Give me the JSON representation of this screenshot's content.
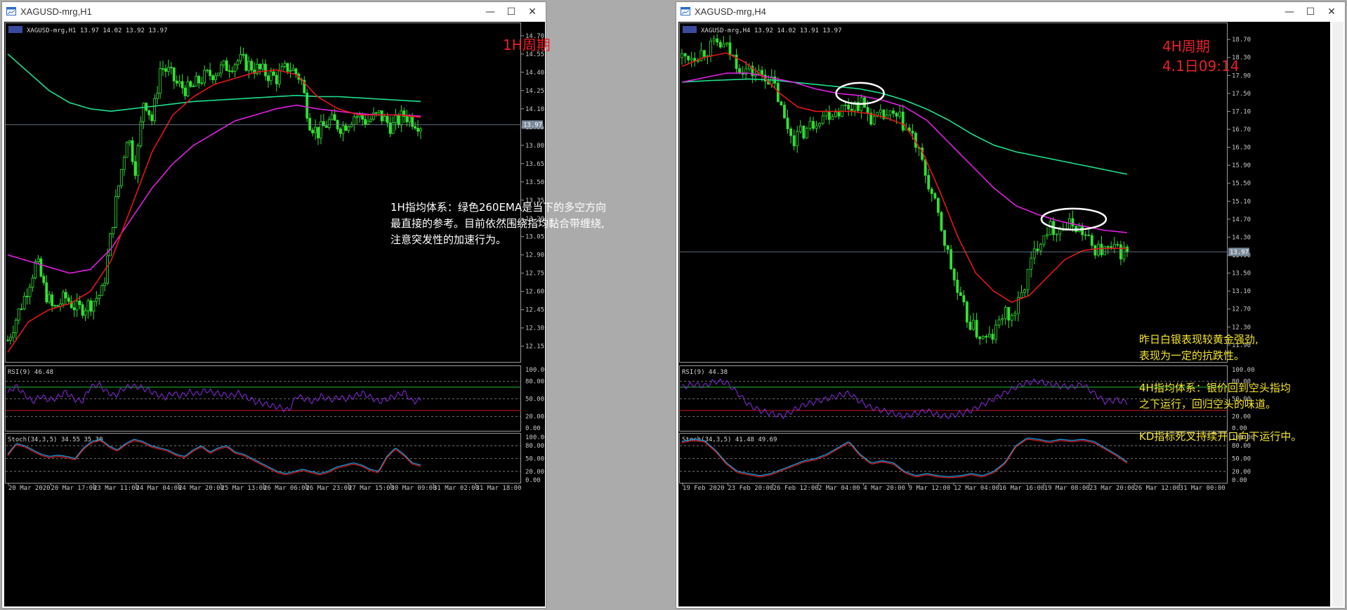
{
  "windows": [
    {
      "title": "XAGUSD-mrg,H1",
      "ticker": "XAGUSD-mrg,H1  13.97 14.02 13.92 13.97",
      "period_label": "1H周期",
      "period_sub": "",
      "notes_color": "#ffffff",
      "notes": [
        "1H指均体系：绿色260EMA是当下的多空方向",
        "最直接的参考。目前依然围绕指均黏合带缠绕,",
        "注意突发性的加速行为。"
      ],
      "current_price": "13.97",
      "rsi_label": "RSI(9) 46.48",
      "stoch_label": "Stoch(34,3,5) 34.55 35.30",
      "date_labels": [
        "20 Mar 2020",
        "20 Mar 17:00",
        "23 Mar 11:00",
        "24 Mar 04:00",
        "24 Mar 20:00",
        "25 Mar 13:00",
        "26 Mar 06:00",
        "26 Mar 23:00",
        "27 Mar 15:00",
        "30 Mar 09:00",
        "31 Mar 02:00",
        "31 Mar 18:00"
      ]
    },
    {
      "title": "XAGUSD-mrg,H4",
      "ticker": "XAGUSD-mrg,H4  13.92 14.02 13.91 13.97",
      "period_label": "4H周期",
      "period_sub": "4.1日09:14",
      "notes_color": "#f5e62a",
      "notes": [
        "昨日白银表现较黄金强劲,",
        "表现为一定的抗跌性。",
        "",
        "4H指均体系：银价回到空头指均",
        "之下运行，回归空头的味道。",
        "",
        "KD指标死叉持续开口向下运行中。"
      ],
      "current_price": "13.97",
      "rsi_label": "RSI(9) 44.38",
      "stoch_label": "Stoch(34,3,5) 41.48 49.69",
      "date_labels": [
        "19 Feb 2020",
        "23 Feb 20:00",
        "26 Feb 12:00",
        "2 Mar 04:00",
        "4 Mar 20:00",
        "9 Mar 12:00",
        "12 Mar 04:00",
        "16 Mar 16:00",
        "19 Mar 08:00",
        "23 Mar 20:00",
        "26 Mar 12:00",
        "31 Mar 00:00"
      ]
    }
  ],
  "controls": {
    "minimize": "—",
    "maximize": "☐",
    "close": "✕"
  },
  "chart_data": [
    {
      "type": "candlestick",
      "title": "XAGUSD-mrg,H1",
      "price_ticks": [
        "14.70",
        "14.55",
        "14.40",
        "14.25",
        "14.10",
        "13.95",
        "13.80",
        "13.65",
        "13.50",
        "13.35",
        "13.20",
        "13.05",
        "12.90",
        "12.75",
        "12.60",
        "12.45",
        "12.30",
        "12.15"
      ],
      "ylim": [
        12.05,
        14.78
      ],
      "close_path": [
        [
          0,
          12.2
        ],
        [
          4,
          12.55
        ],
        [
          7,
          12.85
        ],
        [
          9,
          12.6
        ],
        [
          11,
          12.45
        ],
        [
          14,
          12.55
        ],
        [
          17,
          12.45
        ],
        [
          20,
          12.5
        ],
        [
          23,
          12.6
        ],
        [
          26,
          13.3
        ],
        [
          29,
          13.9
        ],
        [
          31,
          13.6
        ],
        [
          33,
          14.2
        ],
        [
          35,
          14.0
        ],
        [
          37,
          14.45
        ],
        [
          39,
          14.4
        ],
        [
          41,
          14.3
        ],
        [
          44,
          14.25
        ],
        [
          47,
          14.35
        ],
        [
          50,
          14.4
        ],
        [
          53,
          14.45
        ],
        [
          56,
          14.5
        ],
        [
          59,
          14.45
        ],
        [
          62,
          14.4
        ],
        [
          65,
          14.35
        ],
        [
          68,
          14.45
        ],
        [
          71,
          14.35
        ],
        [
          73,
          14.0
        ],
        [
          75,
          13.9
        ],
        [
          78,
          14.0
        ],
        [
          81,
          13.95
        ],
        [
          84,
          14.05
        ],
        [
          87,
          14.0
        ],
        [
          90,
          14.05
        ],
        [
          93,
          13.95
        ],
        [
          96,
          14.05
        ],
        [
          100,
          13.97
        ]
      ],
      "ema_red": [
        [
          0,
          12.1
        ],
        [
          5,
          12.35
        ],
        [
          10,
          12.45
        ],
        [
          15,
          12.5
        ],
        [
          20,
          12.6
        ],
        [
          25,
          12.85
        ],
        [
          30,
          13.3
        ],
        [
          35,
          13.75
        ],
        [
          40,
          14.05
        ],
        [
          45,
          14.2
        ],
        [
          50,
          14.3
        ],
        [
          55,
          14.35
        ],
        [
          60,
          14.4
        ],
        [
          65,
          14.42
        ],
        [
          70,
          14.38
        ],
        [
          75,
          14.2
        ],
        [
          80,
          14.1
        ],
        [
          85,
          14.05
        ],
        [
          90,
          14.05
        ],
        [
          95,
          14.05
        ],
        [
          100,
          14.03
        ]
      ],
      "ema_magenta": [
        [
          0,
          12.9
        ],
        [
          5,
          12.85
        ],
        [
          10,
          12.8
        ],
        [
          15,
          12.75
        ],
        [
          20,
          12.78
        ],
        [
          25,
          12.95
        ],
        [
          30,
          13.2
        ],
        [
          35,
          13.45
        ],
        [
          40,
          13.65
        ],
        [
          45,
          13.8
        ],
        [
          50,
          13.9
        ],
        [
          55,
          14.0
        ],
        [
          60,
          14.05
        ],
        [
          65,
          14.1
        ],
        [
          70,
          14.13
        ],
        [
          75,
          14.1
        ],
        [
          80,
          14.08
        ],
        [
          85,
          14.06
        ],
        [
          90,
          14.05
        ],
        [
          95,
          14.05
        ],
        [
          100,
          14.04
        ]
      ],
      "ema_green": [
        [
          0,
          14.55
        ],
        [
          5,
          14.4
        ],
        [
          10,
          14.25
        ],
        [
          15,
          14.15
        ],
        [
          20,
          14.1
        ],
        [
          25,
          14.08
        ],
        [
          30,
          14.1
        ],
        [
          35,
          14.12
        ],
        [
          40,
          14.14
        ],
        [
          45,
          14.16
        ],
        [
          50,
          14.17
        ],
        [
          55,
          14.18
        ],
        [
          60,
          14.19
        ],
        [
          65,
          14.2
        ],
        [
          70,
          14.21
        ],
        [
          75,
          14.2
        ],
        [
          80,
          14.2
        ],
        [
          85,
          14.19
        ],
        [
          90,
          14.18
        ],
        [
          95,
          14.17
        ],
        [
          100,
          14.16
        ]
      ],
      "rsi_ticks": [
        "100.00",
        "80.00",
        "50.00",
        "20.00",
        "0.00"
      ],
      "rsi_values": [
        60,
        72,
        58,
        45,
        55,
        48,
        52,
        62,
        50,
        45,
        70,
        75,
        62,
        55,
        68,
        72,
        70,
        65,
        58,
        52,
        60,
        55,
        62,
        58,
        65,
        60,
        58,
        55,
        60,
        52,
        45,
        42,
        38,
        35,
        30,
        55,
        50,
        45,
        55,
        48,
        52,
        50,
        55,
        60,
        52,
        45,
        50,
        55,
        62,
        45,
        48
      ],
      "stoch_ticks": [
        "100.00",
        "80.00",
        "50.00",
        "20.00",
        "0.00"
      ],
      "stoch_values": [
        60,
        85,
        80,
        70,
        60,
        55,
        58,
        55,
        50,
        75,
        90,
        95,
        80,
        70,
        85,
        95,
        90,
        80,
        75,
        70,
        60,
        55,
        70,
        80,
        65,
        75,
        80,
        65,
        60,
        50,
        40,
        30,
        20,
        15,
        20,
        25,
        20,
        15,
        20,
        30,
        35,
        40,
        35,
        25,
        20,
        55,
        75,
        60,
        40,
        35
      ]
    },
    {
      "type": "candlestick",
      "title": "XAGUSD-mrg,H4",
      "price_ticks": [
        "18.70",
        "18.30",
        "17.90",
        "17.50",
        "17.10",
        "16.70",
        "16.30",
        "15.90",
        "15.50",
        "15.10",
        "14.70",
        "14.30",
        "13.90",
        "13.50",
        "13.10",
        "12.70",
        "12.30",
        "11.90"
      ],
      "ylim": [
        11.6,
        19.0
      ],
      "close_path": [
        [
          0,
          18.3
        ],
        [
          4,
          18.4
        ],
        [
          8,
          18.6
        ],
        [
          10,
          18.5
        ],
        [
          13,
          18.1
        ],
        [
          16,
          17.95
        ],
        [
          19,
          17.9
        ],
        [
          21,
          17.6
        ],
        [
          23,
          16.9
        ],
        [
          25,
          16.5
        ],
        [
          28,
          16.7
        ],
        [
          31,
          17.0
        ],
        [
          34,
          17.1
        ],
        [
          37,
          17.2
        ],
        [
          40,
          17.3
        ],
        [
          43,
          16.9
        ],
        [
          46,
          17.0
        ],
        [
          49,
          16.9
        ],
        [
          52,
          16.5
        ],
        [
          55,
          15.6
        ],
        [
          58,
          14.6
        ],
        [
          60,
          13.8
        ],
        [
          62,
          13.0
        ],
        [
          64,
          12.5
        ],
        [
          66,
          12.2
        ],
        [
          68,
          12.0
        ],
        [
          70,
          12.1
        ],
        [
          72,
          12.6
        ],
        [
          74,
          12.5
        ],
        [
          76,
          12.9
        ],
        [
          78,
          13.6
        ],
        [
          80,
          14.2
        ],
        [
          82,
          14.5
        ],
        [
          84,
          14.5
        ],
        [
          86,
          14.5
        ],
        [
          88,
          14.6
        ],
        [
          90,
          14.4
        ],
        [
          92,
          14.1
        ],
        [
          94,
          14.0
        ],
        [
          96,
          14.0
        ],
        [
          100,
          13.97
        ]
      ],
      "ema_red": [
        [
          0,
          18.1
        ],
        [
          5,
          18.3
        ],
        [
          10,
          18.4
        ],
        [
          14,
          18.2
        ],
        [
          18,
          17.9
        ],
        [
          22,
          17.5
        ],
        [
          26,
          17.2
        ],
        [
          30,
          17.1
        ],
        [
          34,
          17.1
        ],
        [
          38,
          17.1
        ],
        [
          42,
          17.05
        ],
        [
          46,
          16.95
        ],
        [
          50,
          16.8
        ],
        [
          54,
          16.2
        ],
        [
          58,
          15.3
        ],
        [
          62,
          14.3
        ],
        [
          66,
          13.5
        ],
        [
          70,
          13.1
        ],
        [
          74,
          12.85
        ],
        [
          78,
          13.0
        ],
        [
          82,
          13.4
        ],
        [
          86,
          13.8
        ],
        [
          90,
          14.0
        ],
        [
          94,
          14.05
        ],
        [
          100,
          14.05
        ]
      ],
      "ema_magenta": [
        [
          0,
          17.75
        ],
        [
          5,
          17.85
        ],
        [
          10,
          17.95
        ],
        [
          15,
          17.95
        ],
        [
          20,
          17.85
        ],
        [
          25,
          17.75
        ],
        [
          30,
          17.6
        ],
        [
          35,
          17.5
        ],
        [
          40,
          17.45
        ],
        [
          45,
          17.35
        ],
        [
          50,
          17.2
        ],
        [
          55,
          16.9
        ],
        [
          60,
          16.4
        ],
        [
          65,
          15.9
        ],
        [
          70,
          15.4
        ],
        [
          75,
          15.0
        ],
        [
          80,
          14.8
        ],
        [
          85,
          14.65
        ],
        [
          90,
          14.55
        ],
        [
          95,
          14.45
        ],
        [
          100,
          14.4
        ]
      ],
      "ema_green": [
        [
          0,
          17.75
        ],
        [
          5,
          17.78
        ],
        [
          10,
          17.8
        ],
        [
          15,
          17.82
        ],
        [
          20,
          17.8
        ],
        [
          25,
          17.75
        ],
        [
          30,
          17.7
        ],
        [
          35,
          17.65
        ],
        [
          40,
          17.6
        ],
        [
          45,
          17.5
        ],
        [
          50,
          17.35
        ],
        [
          55,
          17.15
        ],
        [
          60,
          16.9
        ],
        [
          65,
          16.6
        ],
        [
          70,
          16.35
        ],
        [
          75,
          16.2
        ],
        [
          80,
          16.1
        ],
        [
          85,
          16.0
        ],
        [
          90,
          15.9
        ],
        [
          95,
          15.8
        ],
        [
          100,
          15.7
        ]
      ],
      "rsi_ticks": [
        "100.00",
        "80.00",
        "50.00",
        "20.00",
        "0.00"
      ],
      "rsi_values": [
        70,
        75,
        72,
        80,
        78,
        60,
        40,
        30,
        25,
        20,
        30,
        40,
        45,
        50,
        55,
        60,
        45,
        35,
        30,
        25,
        20,
        25,
        30,
        22,
        20,
        25,
        30,
        40,
        50,
        60,
        70,
        78,
        80,
        75,
        72,
        70,
        75,
        60,
        45,
        48,
        44
      ],
      "stoch_ticks": [
        "100.00",
        "80.00",
        "50.00",
        "20.00",
        "0.00"
      ],
      "stoch_values": [
        90,
        95,
        92,
        70,
        40,
        20,
        15,
        10,
        15,
        25,
        35,
        45,
        50,
        60,
        75,
        90,
        60,
        40,
        45,
        40,
        20,
        10,
        15,
        10,
        8,
        10,
        15,
        10,
        20,
        40,
        80,
        98,
        95,
        90,
        95,
        92,
        95,
        90,
        75,
        60,
        42
      ]
    }
  ]
}
